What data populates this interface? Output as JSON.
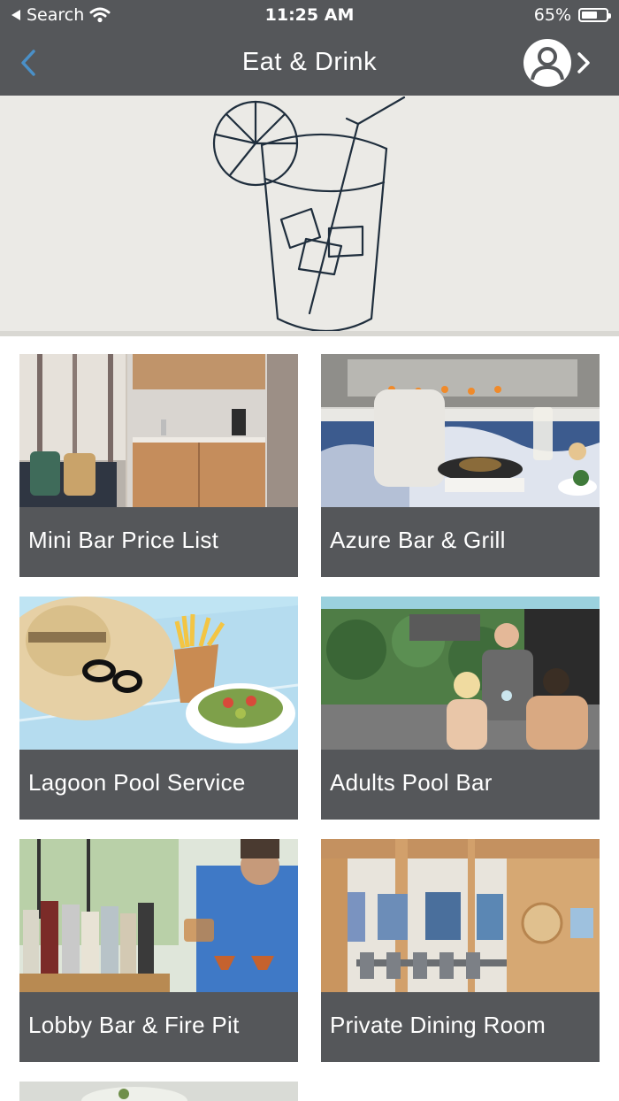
{
  "status_bar": {
    "back_app": "Search",
    "time": "11:25 AM",
    "battery_percent": "65%",
    "battery_level": 0.65
  },
  "nav": {
    "title": "Eat & Drink",
    "back_icon": "chevron-left-icon",
    "account_icon": "user-circle-icon",
    "account_chevron": "chevron-right-icon"
  },
  "hero": {
    "illustration": "drink-glass-icon"
  },
  "cards": [
    {
      "label": "Mini Bar Price List",
      "image": "minibar-photo"
    },
    {
      "label": "Azure Bar & Grill",
      "image": "grill-photo"
    },
    {
      "label": "Lagoon Pool Service",
      "image": "pool-service-photo"
    },
    {
      "label": "Adults Pool Bar",
      "image": "pool-bar-photo"
    },
    {
      "label": "Lobby Bar & Fire Pit",
      "image": "lobby-bar-photo"
    },
    {
      "label": "Private Dining Room",
      "image": "dining-room-photo"
    }
  ],
  "colors": {
    "bar": "#55575a",
    "accent_blue": "#4a90c8",
    "hero_bg": "#ebeae6",
    "line_art": "#1f2e3d"
  }
}
